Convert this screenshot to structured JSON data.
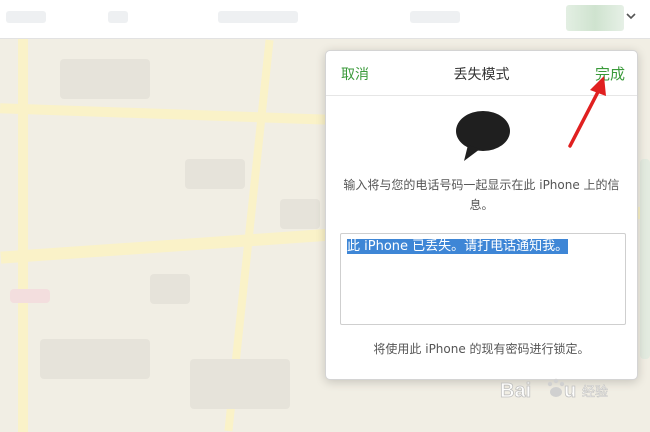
{
  "dialog": {
    "cancel_label": "取消",
    "title": "丢失模式",
    "done_label": "完成",
    "description": "输入将与您的电话号码一起显示在此 iPhone 上的信息。",
    "message_value": "此 iPhone 已丢失。请打电话通知我。",
    "footnote": "将使用此 iPhone 的现有密码进行锁定。"
  },
  "icons": {
    "bubble": "speech-bubble-icon",
    "chevron": "chevron-down-icon",
    "arrow": "red-arrow-annotation"
  },
  "colors": {
    "accent_green": "#3a9a3a",
    "selection_blue": "#3e86d6",
    "annotation_red": "#e02020"
  },
  "watermark": {
    "text": "Baidu 经验"
  }
}
